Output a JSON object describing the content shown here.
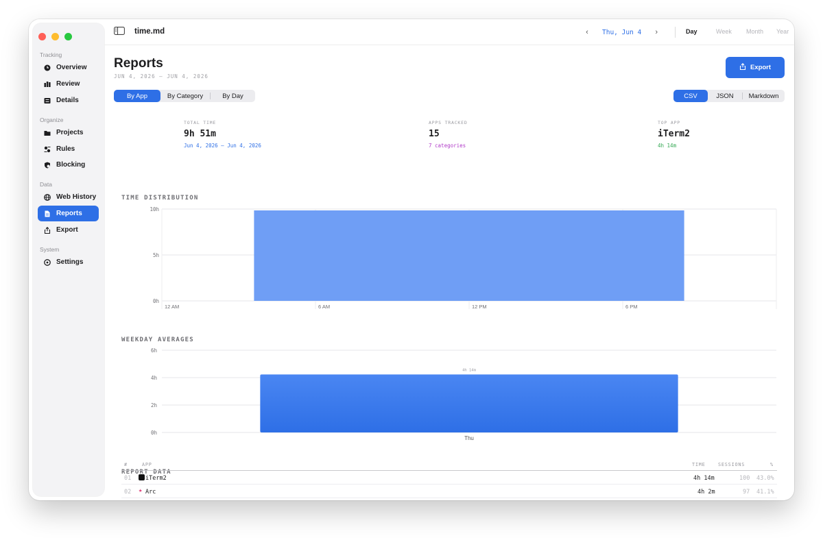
{
  "app": {
    "doc_title": "time.md"
  },
  "sidebar": {
    "sections": [
      {
        "label": "Tracking"
      },
      {
        "label": "Organize"
      },
      {
        "label": "Data"
      },
      {
        "label": "System"
      }
    ],
    "items": [
      {
        "label": "Overview",
        "icon": "clock-icon"
      },
      {
        "label": "Review",
        "icon": "bar-chart-icon"
      },
      {
        "label": "Details",
        "icon": "list-icon"
      },
      {
        "label": "Projects",
        "icon": "folder-icon"
      },
      {
        "label": "Rules",
        "icon": "rules-icon"
      },
      {
        "label": "Blocking",
        "icon": "block-icon"
      },
      {
        "label": "Web History",
        "icon": "globe-icon"
      },
      {
        "label": "Reports",
        "icon": "document-icon",
        "active": true
      },
      {
        "label": "Export",
        "icon": "share-icon"
      },
      {
        "label": "Settings",
        "icon": "gear-icon"
      }
    ]
  },
  "datenav": {
    "date": "Thu, Jun 4",
    "ranges": [
      "Day",
      "Week",
      "Month",
      "Year"
    ],
    "active_range": "Day"
  },
  "page": {
    "title": "Reports",
    "subtitle": "JUN 4, 2026 — JUN 4, 2026",
    "export_label": "Export",
    "group_tabs": [
      "By App",
      "By Category",
      "By Day"
    ],
    "active_group": "By App",
    "format_tabs": [
      "CSV",
      "JSON",
      "Markdown"
    ],
    "active_format": "CSV"
  },
  "stats": [
    {
      "label": "TOTAL TIME",
      "value": "9h 51m",
      "sub": "Jun 4, 2026 — Jun 4, 2026",
      "sub_color": "#2e6fe6"
    },
    {
      "label": "APPS TRACKED",
      "value": "15",
      "sub": "7 categories",
      "sub_color": "#b03ac8"
    },
    {
      "label": "TOP APP",
      "value": "iTerm2",
      "sub": "4h 14m",
      "sub_color": "#34a853"
    }
  ],
  "sections": {
    "time_distribution": "TIME DISTRIBUTION",
    "weekday_averages": "WEEKDAY AVERAGES",
    "report_data": "REPORT DATA"
  },
  "chart_data": [
    {
      "type": "area",
      "title": "TIME DISTRIBUTION",
      "y_ticks": [
        "10h",
        "5h",
        "0h"
      ],
      "x_ticks": [
        "12 AM",
        "6 AM",
        "12 PM",
        "6 PM"
      ],
      "ylim": [
        0,
        10
      ],
      "xlim": [
        0,
        24
      ],
      "x": [
        3.6,
        20.4
      ],
      "values": [
        9.85,
        9.85
      ],
      "color": "#6f9ef5",
      "grid": true
    },
    {
      "type": "bar",
      "title": "WEEKDAY AVERAGES",
      "y_ticks": [
        "6h",
        "4h",
        "2h",
        "0h"
      ],
      "ylim": [
        0,
        6
      ],
      "categories": [
        "Thu"
      ],
      "values": [
        4.23
      ],
      "data_labels": [
        "4h 14m"
      ],
      "color": "#2e6fe6",
      "grid": true
    }
  ],
  "table": {
    "headers": {
      "num": "#",
      "app": "APP",
      "time": "TIME",
      "sessions": "SESSIONS",
      "pct": "%"
    },
    "rows": [
      {
        "num": "01",
        "app": "iTerm2",
        "icon": "terminal-icon",
        "time": "4h 14m",
        "sessions": "100",
        "pct": "43.0%"
      },
      {
        "num": "02",
        "app": "Arc",
        "icon": "arc-icon",
        "time": "4h 2m",
        "sessions": "97",
        "pct": "41.1%"
      }
    ]
  }
}
